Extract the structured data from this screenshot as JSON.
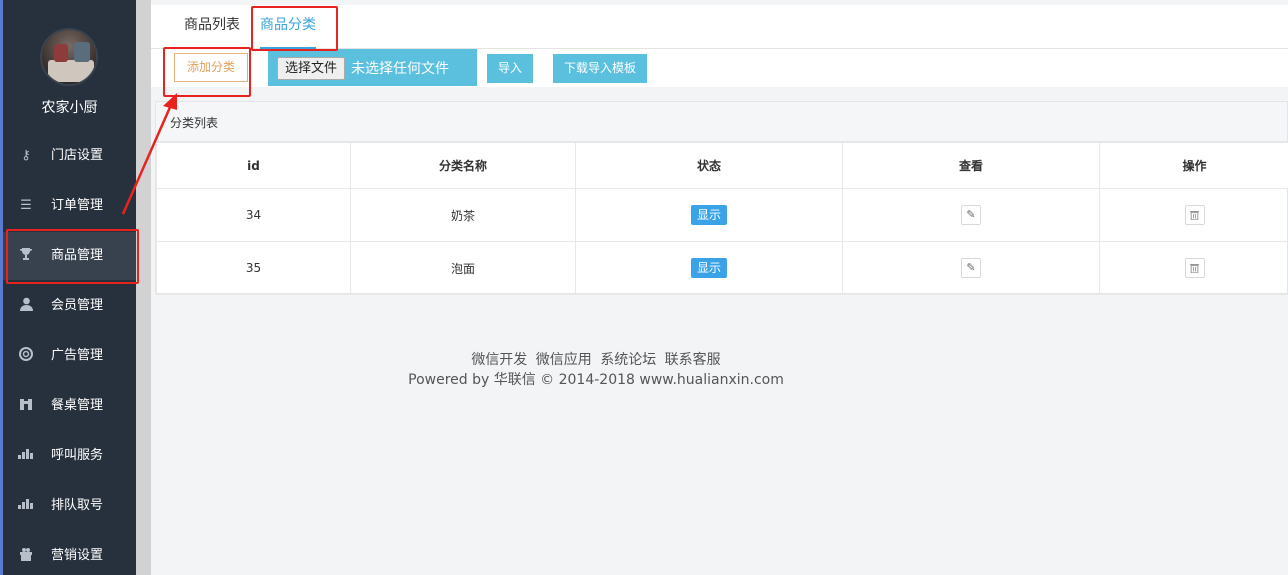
{
  "sidebar": {
    "shop_name": "农家小厨",
    "items": [
      {
        "label": "门店设置",
        "icon": "key-icon"
      },
      {
        "label": "订单管理",
        "icon": "list-icon"
      },
      {
        "label": "商品管理",
        "icon": "trophy-icon",
        "active": true
      },
      {
        "label": "会员管理",
        "icon": "user-icon"
      },
      {
        "label": "广告管理",
        "icon": "lifebuoy-icon"
      },
      {
        "label": "餐桌管理",
        "icon": "binoculars-icon"
      },
      {
        "label": "呼叫服务",
        "icon": "signal-icon"
      },
      {
        "label": "排队取号",
        "icon": "signal-icon"
      },
      {
        "label": "营销设置",
        "icon": "gift-icon"
      }
    ]
  },
  "tabs": [
    {
      "label": "商品列表",
      "active": false
    },
    {
      "label": "商品分类",
      "active": true
    }
  ],
  "toolbar": {
    "add_label": "添加分类",
    "file_button": "选择文件",
    "file_status": "未选择任何文件",
    "import_label": "导入",
    "download_label": "下载导入模板"
  },
  "panel": {
    "title": "分类列表",
    "columns": [
      "id",
      "分类名称",
      "状态",
      "查看",
      "操作"
    ],
    "rows": [
      {
        "id": "34",
        "name": "奶茶",
        "status": "显示"
      },
      {
        "id": "35",
        "name": "泡面",
        "status": "显示"
      }
    ]
  },
  "footer": {
    "links": [
      "微信开发",
      "微信应用",
      "系统论坛",
      "联系客服"
    ],
    "copyright": "Powered by 华联信 © 2014-2018 www.hualianxin.com"
  },
  "colors": {
    "sidebar_bg": "#27313d",
    "accent": "#3aa3db",
    "info_button": "#5bc0de",
    "annotation": "#e8231f"
  }
}
